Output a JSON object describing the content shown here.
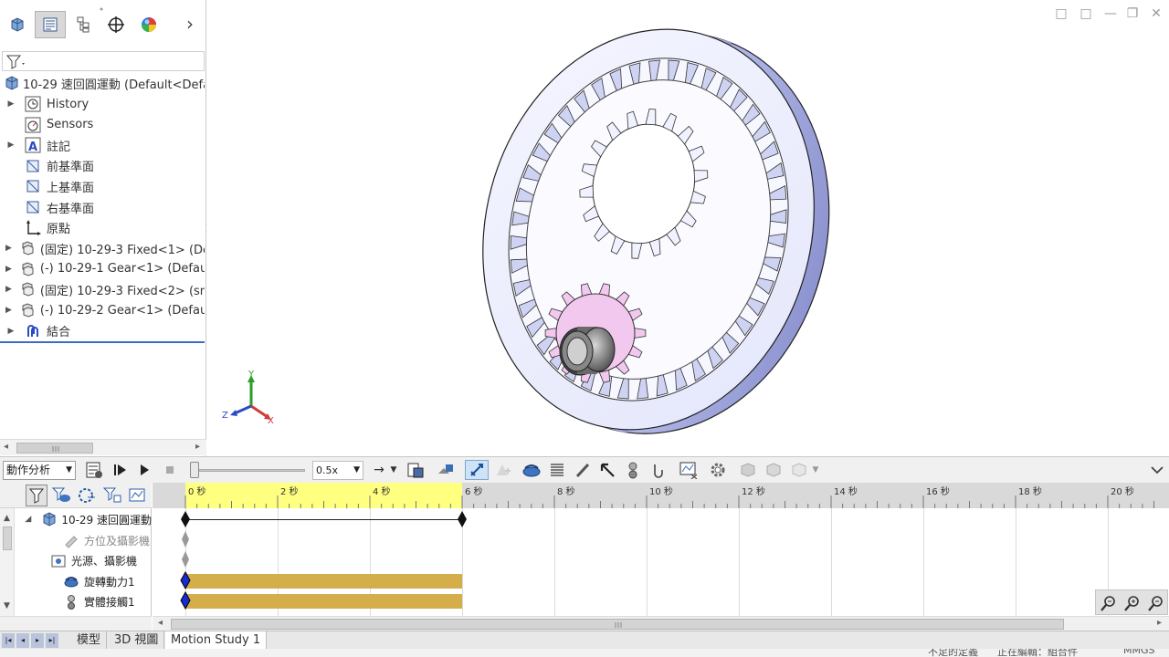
{
  "feature_manager": {
    "tabs": [
      {
        "icon": "part-icon"
      },
      {
        "icon": "property-manager-icon"
      },
      {
        "icon": "configuration-manager-icon"
      },
      {
        "icon": "dimxpert-icon"
      },
      {
        "icon": "appearance-icon"
      }
    ],
    "more_label": "›",
    "filter_icon": "filter-icon",
    "root_label": "10-29 速回圓運動  (Default<Default",
    "items": [
      {
        "label": "History",
        "icon": "history-icon",
        "expandable": true
      },
      {
        "label": "Sensors",
        "icon": "sensors-icon",
        "expandable": false
      },
      {
        "label": "註記",
        "icon": "annotations-icon",
        "expandable": true
      },
      {
        "label": "前基準面",
        "icon": "plane-icon",
        "expandable": false
      },
      {
        "label": "上基準面",
        "icon": "plane-icon",
        "expandable": false
      },
      {
        "label": "右基準面",
        "icon": "plane-icon",
        "expandable": false
      },
      {
        "label": "原點",
        "icon": "origin-icon",
        "expandable": false
      },
      {
        "label": "(固定) 10-29-3 Fixed<1> (Def",
        "icon": "component-icon",
        "expandable": true
      },
      {
        "label": "(-) 10-29-1 Gear<1> (Default",
        "icon": "component-icon",
        "expandable": true
      },
      {
        "label": "(固定) 10-29-3 Fixed<2> (sma",
        "icon": "component-icon",
        "expandable": true
      },
      {
        "label": "(-) 10-29-2 Gear<1> (Default",
        "icon": "component-icon",
        "expandable": true
      },
      {
        "label": "結合",
        "icon": "mates-icon",
        "expandable": true
      }
    ]
  },
  "viewport": {
    "triad": {
      "x": "X",
      "y": "Y",
      "z": "Z"
    },
    "window_buttons": [
      "□",
      "□",
      "—",
      "❐",
      "✕"
    ]
  },
  "motion_manager": {
    "study_type": "動作分析",
    "speed": "0.5x",
    "ruler_ticks": [
      "0 秒",
      "2 秒",
      "4 秒",
      "6 秒",
      "8 秒",
      "10 秒",
      "12 秒",
      "14 秒",
      "16 秒",
      "18 秒",
      "20 秒"
    ],
    "tree_root": "10-29 速回圓運動",
    "tree_items": [
      {
        "label": "方位及攝影機",
        "icon": "orientation-icon",
        "dim": true
      },
      {
        "label": "光源、攝影機",
        "icon": "lights-icon",
        "dim": false
      },
      {
        "label": "旋轉動力1",
        "icon": "motor-icon",
        "dim": false
      },
      {
        "label": "實體接觸1",
        "icon": "contact-icon",
        "dim": false
      }
    ],
    "duration_seconds": 6
  },
  "bottom_tabs": {
    "model": "模型",
    "view3d": "3D 視圖",
    "study": "Motion Study 1"
  },
  "status_bar": {
    "text1": "不足的定義",
    "text2": "正在編輯：組合件",
    "text3": "MMGS"
  }
}
